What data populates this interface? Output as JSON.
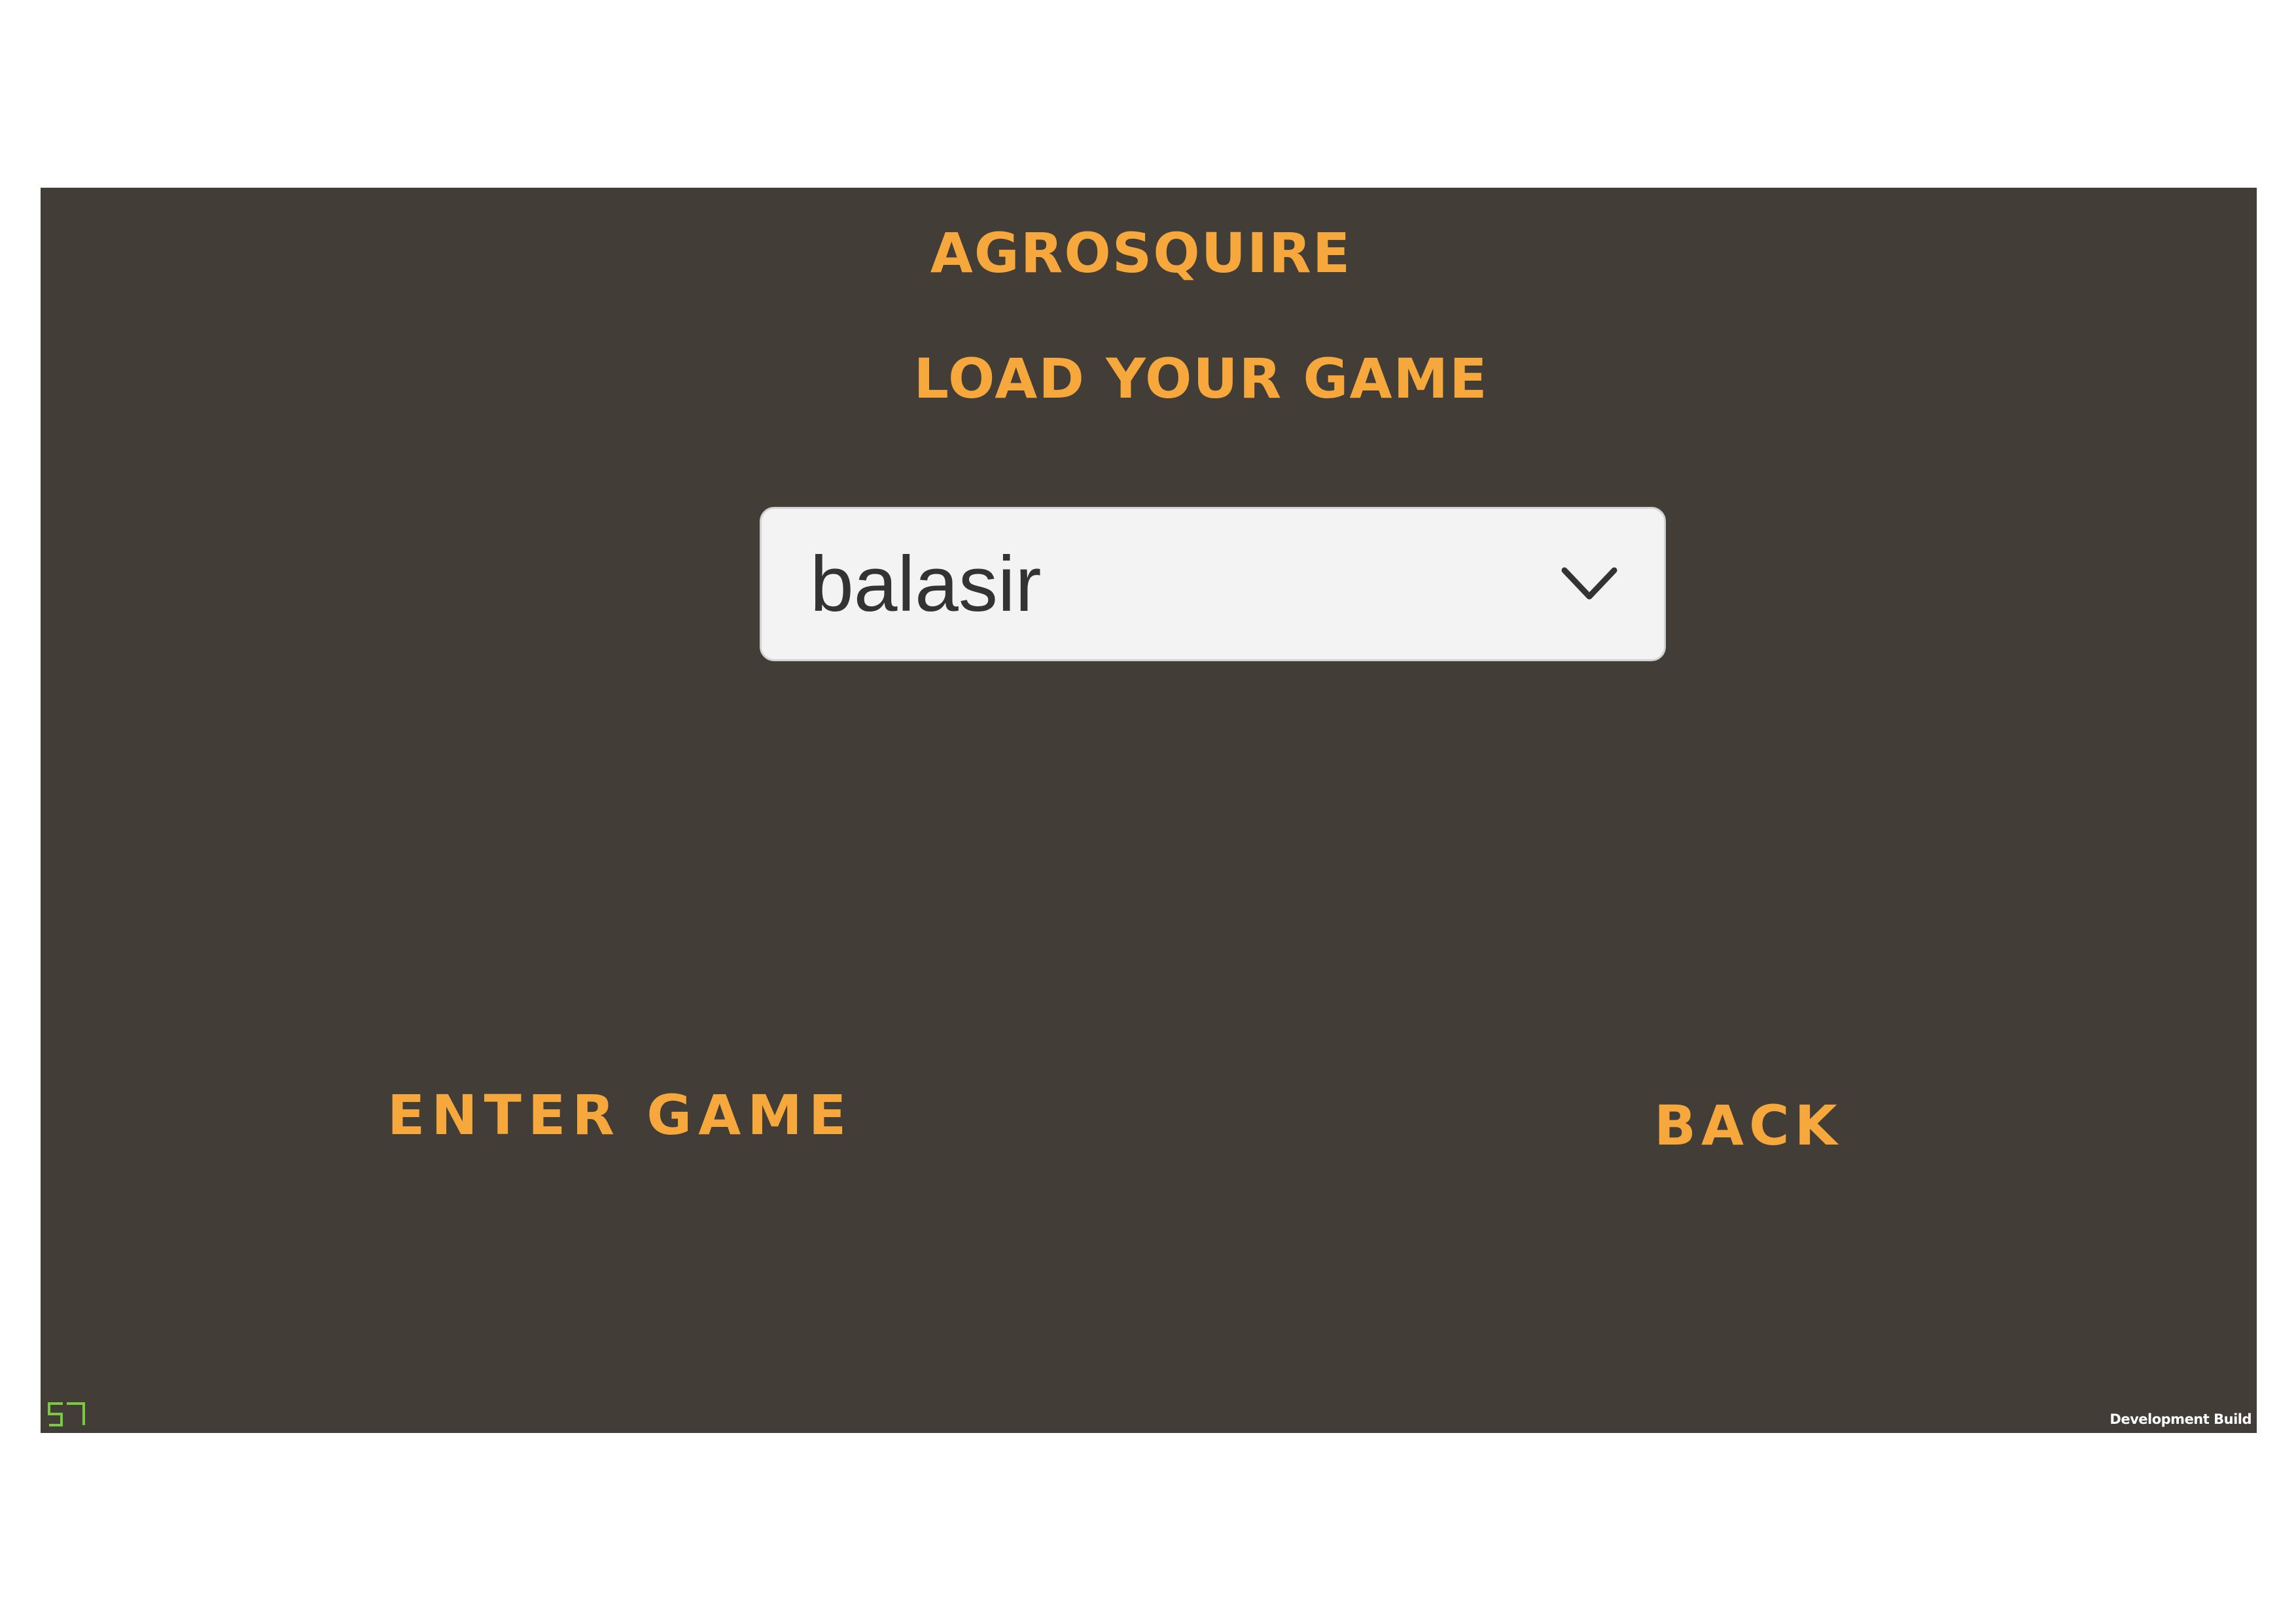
{
  "app": {
    "title": "AGROSQUIRE",
    "screen_heading": "LOAD YOUR GAME"
  },
  "save_select": {
    "selected_value": "balasir",
    "arrow_icon": "chevron-down-icon"
  },
  "actions": {
    "enter_label": "ENTER GAME",
    "back_label": "BACK"
  },
  "footer": {
    "build_label": "Development Build",
    "logo_icon": "build-logo-icon"
  },
  "colors": {
    "background": "#433d38",
    "accent": "#f6a83c",
    "dropdown_bg": "#f3f3f3",
    "logo": "#7ac943"
  }
}
